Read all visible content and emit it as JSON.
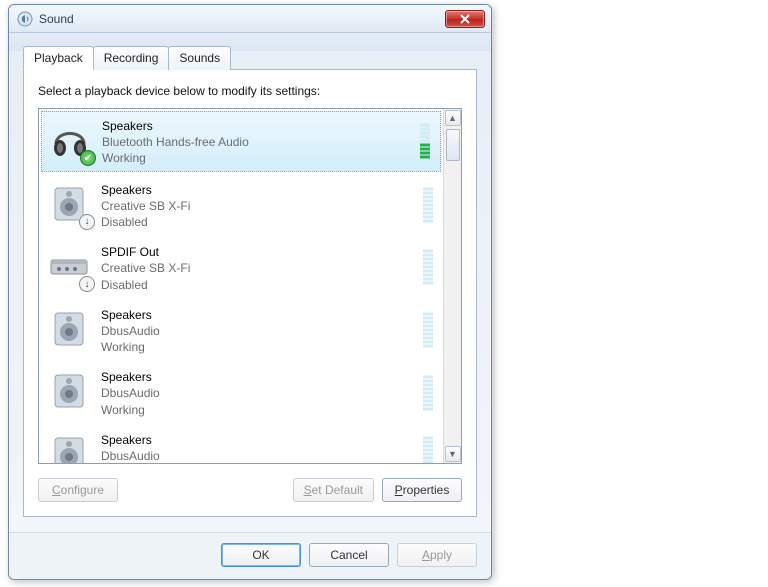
{
  "window": {
    "title": "Sound"
  },
  "tabs": [
    {
      "label": "Playback",
      "active": true
    },
    {
      "label": "Recording",
      "active": false
    },
    {
      "label": "Sounds",
      "active": false
    }
  ],
  "instruction": "Select a playback device below to modify its settings:",
  "devices": [
    {
      "name": "Speakers",
      "desc": "Bluetooth Hands-free Audio",
      "status": "Working",
      "icon": "headphones",
      "badge": "default",
      "selected": true,
      "vu": "active"
    },
    {
      "name": "Speakers",
      "desc": "Creative SB X-Fi",
      "status": "Disabled",
      "icon": "speaker",
      "badge": "disabled",
      "selected": false,
      "vu": "idle"
    },
    {
      "name": "SPDIF Out",
      "desc": "Creative SB X-Fi",
      "status": "Disabled",
      "icon": "spdif",
      "badge": "disabled",
      "selected": false,
      "vu": "idle"
    },
    {
      "name": "Speakers",
      "desc": "DbusAudio",
      "status": "Working",
      "icon": "speaker",
      "badge": null,
      "selected": false,
      "vu": "idle"
    },
    {
      "name": "Speakers",
      "desc": "DbusAudio",
      "status": "Working",
      "icon": "speaker",
      "badge": null,
      "selected": false,
      "vu": "idle"
    },
    {
      "name": "Speakers",
      "desc": "DbusAudio",
      "status": "",
      "icon": "speaker",
      "badge": null,
      "selected": false,
      "vu": "idle"
    }
  ],
  "buttons": {
    "configure": "Configure",
    "setdefault": "Set Default",
    "properties": "Properties",
    "ok": "OK",
    "cancel": "Cancel",
    "apply": "Apply"
  },
  "mnemonics": {
    "configure": "C",
    "setdefault": "S",
    "properties": "P",
    "apply": "A"
  }
}
